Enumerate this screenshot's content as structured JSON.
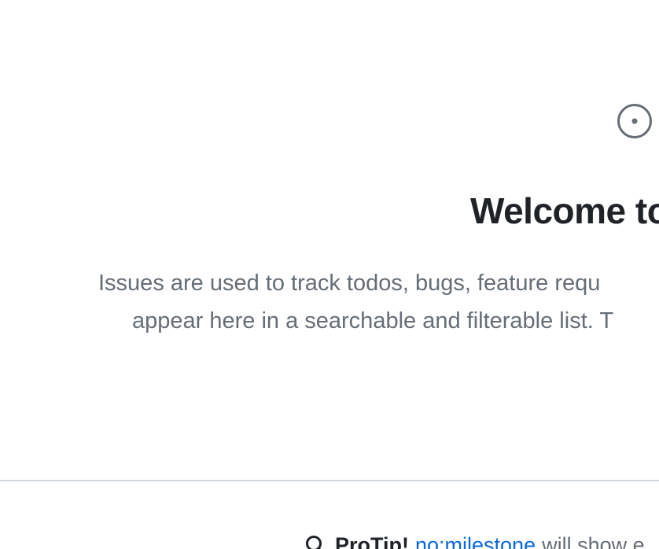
{
  "blankslate": {
    "icon": "issue-opened-icon",
    "title": "Welcome to",
    "description_line_1": "Issues are used to track todos, bugs, feature requ",
    "description_line_2": "appear here in a searchable and filterable list. T"
  },
  "protip": {
    "icon": "search-icon",
    "label": "ProTip!",
    "link_text": "no:milestone",
    "trailing_text": "will show e"
  },
  "colors": {
    "text_primary": "#1f2328",
    "text_muted": "#656d76",
    "link": "#0969da",
    "border": "#d0d7de"
  }
}
